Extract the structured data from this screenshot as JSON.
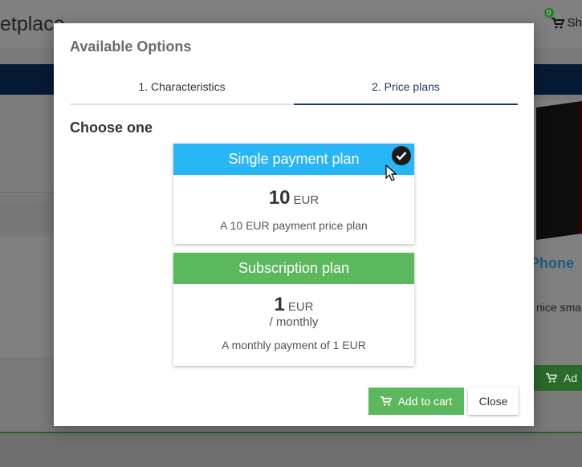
{
  "background": {
    "brand": "etplace",
    "cart_count": "0",
    "cart_label": "Sh",
    "product_name": "Phone",
    "product_desc": "nice sma",
    "add_label": "Ad",
    "icons": {
      "cart": "shopping-cart-icon"
    }
  },
  "modal": {
    "title": "Available Options",
    "tabs": [
      {
        "label": "1. Characteristics",
        "active": false
      },
      {
        "label": "2. Price plans",
        "active": true
      }
    ],
    "choose_label": "Choose one",
    "plans": [
      {
        "title": "Single payment plan",
        "amount": "10",
        "currency": "EUR",
        "period": "",
        "description": "A 10 EUR payment price plan",
        "selected": true,
        "color": "#29b6f6"
      },
      {
        "title": "Subscription plan",
        "amount": "1",
        "currency": "EUR",
        "period": "/ monthly",
        "description": "A monthly payment of 1 EUR",
        "selected": false,
        "color": "#5cb85c"
      }
    ],
    "add_to_cart_label": "Add to cart",
    "close_label": "Close"
  },
  "colors": {
    "primary_tab": "#1b3a5c",
    "success": "#5cb85c",
    "info": "#29b6f6"
  }
}
